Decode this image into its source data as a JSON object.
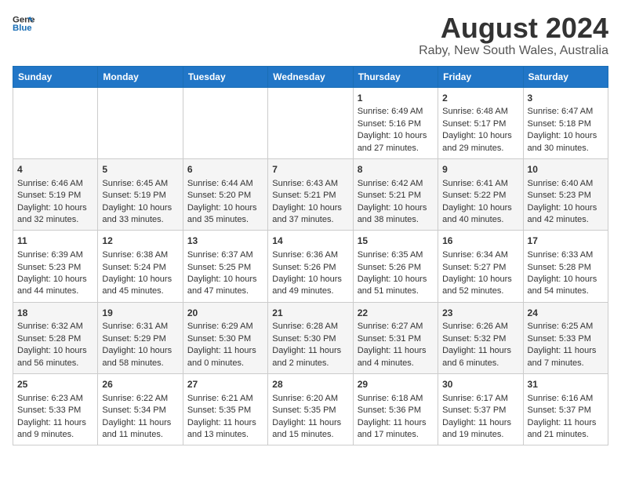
{
  "header": {
    "logo_line1": "General",
    "logo_line2": "Blue",
    "title": "August 2024",
    "subtitle": "Raby, New South Wales, Australia"
  },
  "days_of_week": [
    "Sunday",
    "Monday",
    "Tuesday",
    "Wednesday",
    "Thursday",
    "Friday",
    "Saturday"
  ],
  "weeks": [
    [
      {
        "day": "",
        "content": ""
      },
      {
        "day": "",
        "content": ""
      },
      {
        "day": "",
        "content": ""
      },
      {
        "day": "",
        "content": ""
      },
      {
        "day": "1",
        "content": "Sunrise: 6:49 AM\nSunset: 5:16 PM\nDaylight: 10 hours\nand 27 minutes."
      },
      {
        "day": "2",
        "content": "Sunrise: 6:48 AM\nSunset: 5:17 PM\nDaylight: 10 hours\nand 29 minutes."
      },
      {
        "day": "3",
        "content": "Sunrise: 6:47 AM\nSunset: 5:18 PM\nDaylight: 10 hours\nand 30 minutes."
      }
    ],
    [
      {
        "day": "4",
        "content": "Sunrise: 6:46 AM\nSunset: 5:19 PM\nDaylight: 10 hours\nand 32 minutes."
      },
      {
        "day": "5",
        "content": "Sunrise: 6:45 AM\nSunset: 5:19 PM\nDaylight: 10 hours\nand 33 minutes."
      },
      {
        "day": "6",
        "content": "Sunrise: 6:44 AM\nSunset: 5:20 PM\nDaylight: 10 hours\nand 35 minutes."
      },
      {
        "day": "7",
        "content": "Sunrise: 6:43 AM\nSunset: 5:21 PM\nDaylight: 10 hours\nand 37 minutes."
      },
      {
        "day": "8",
        "content": "Sunrise: 6:42 AM\nSunset: 5:21 PM\nDaylight: 10 hours\nand 38 minutes."
      },
      {
        "day": "9",
        "content": "Sunrise: 6:41 AM\nSunset: 5:22 PM\nDaylight: 10 hours\nand 40 minutes."
      },
      {
        "day": "10",
        "content": "Sunrise: 6:40 AM\nSunset: 5:23 PM\nDaylight: 10 hours\nand 42 minutes."
      }
    ],
    [
      {
        "day": "11",
        "content": "Sunrise: 6:39 AM\nSunset: 5:23 PM\nDaylight: 10 hours\nand 44 minutes."
      },
      {
        "day": "12",
        "content": "Sunrise: 6:38 AM\nSunset: 5:24 PM\nDaylight: 10 hours\nand 45 minutes."
      },
      {
        "day": "13",
        "content": "Sunrise: 6:37 AM\nSunset: 5:25 PM\nDaylight: 10 hours\nand 47 minutes."
      },
      {
        "day": "14",
        "content": "Sunrise: 6:36 AM\nSunset: 5:26 PM\nDaylight: 10 hours\nand 49 minutes."
      },
      {
        "day": "15",
        "content": "Sunrise: 6:35 AM\nSunset: 5:26 PM\nDaylight: 10 hours\nand 51 minutes."
      },
      {
        "day": "16",
        "content": "Sunrise: 6:34 AM\nSunset: 5:27 PM\nDaylight: 10 hours\nand 52 minutes."
      },
      {
        "day": "17",
        "content": "Sunrise: 6:33 AM\nSunset: 5:28 PM\nDaylight: 10 hours\nand 54 minutes."
      }
    ],
    [
      {
        "day": "18",
        "content": "Sunrise: 6:32 AM\nSunset: 5:28 PM\nDaylight: 10 hours\nand 56 minutes."
      },
      {
        "day": "19",
        "content": "Sunrise: 6:31 AM\nSunset: 5:29 PM\nDaylight: 10 hours\nand 58 minutes."
      },
      {
        "day": "20",
        "content": "Sunrise: 6:29 AM\nSunset: 5:30 PM\nDaylight: 11 hours\nand 0 minutes."
      },
      {
        "day": "21",
        "content": "Sunrise: 6:28 AM\nSunset: 5:30 PM\nDaylight: 11 hours\nand 2 minutes."
      },
      {
        "day": "22",
        "content": "Sunrise: 6:27 AM\nSunset: 5:31 PM\nDaylight: 11 hours\nand 4 minutes."
      },
      {
        "day": "23",
        "content": "Sunrise: 6:26 AM\nSunset: 5:32 PM\nDaylight: 11 hours\nand 6 minutes."
      },
      {
        "day": "24",
        "content": "Sunrise: 6:25 AM\nSunset: 5:33 PM\nDaylight: 11 hours\nand 7 minutes."
      }
    ],
    [
      {
        "day": "25",
        "content": "Sunrise: 6:23 AM\nSunset: 5:33 PM\nDaylight: 11 hours\nand 9 minutes."
      },
      {
        "day": "26",
        "content": "Sunrise: 6:22 AM\nSunset: 5:34 PM\nDaylight: 11 hours\nand 11 minutes."
      },
      {
        "day": "27",
        "content": "Sunrise: 6:21 AM\nSunset: 5:35 PM\nDaylight: 11 hours\nand 13 minutes."
      },
      {
        "day": "28",
        "content": "Sunrise: 6:20 AM\nSunset: 5:35 PM\nDaylight: 11 hours\nand 15 minutes."
      },
      {
        "day": "29",
        "content": "Sunrise: 6:18 AM\nSunset: 5:36 PM\nDaylight: 11 hours\nand 17 minutes."
      },
      {
        "day": "30",
        "content": "Sunrise: 6:17 AM\nSunset: 5:37 PM\nDaylight: 11 hours\nand 19 minutes."
      },
      {
        "day": "31",
        "content": "Sunrise: 6:16 AM\nSunset: 5:37 PM\nDaylight: 11 hours\nand 21 minutes."
      }
    ]
  ]
}
